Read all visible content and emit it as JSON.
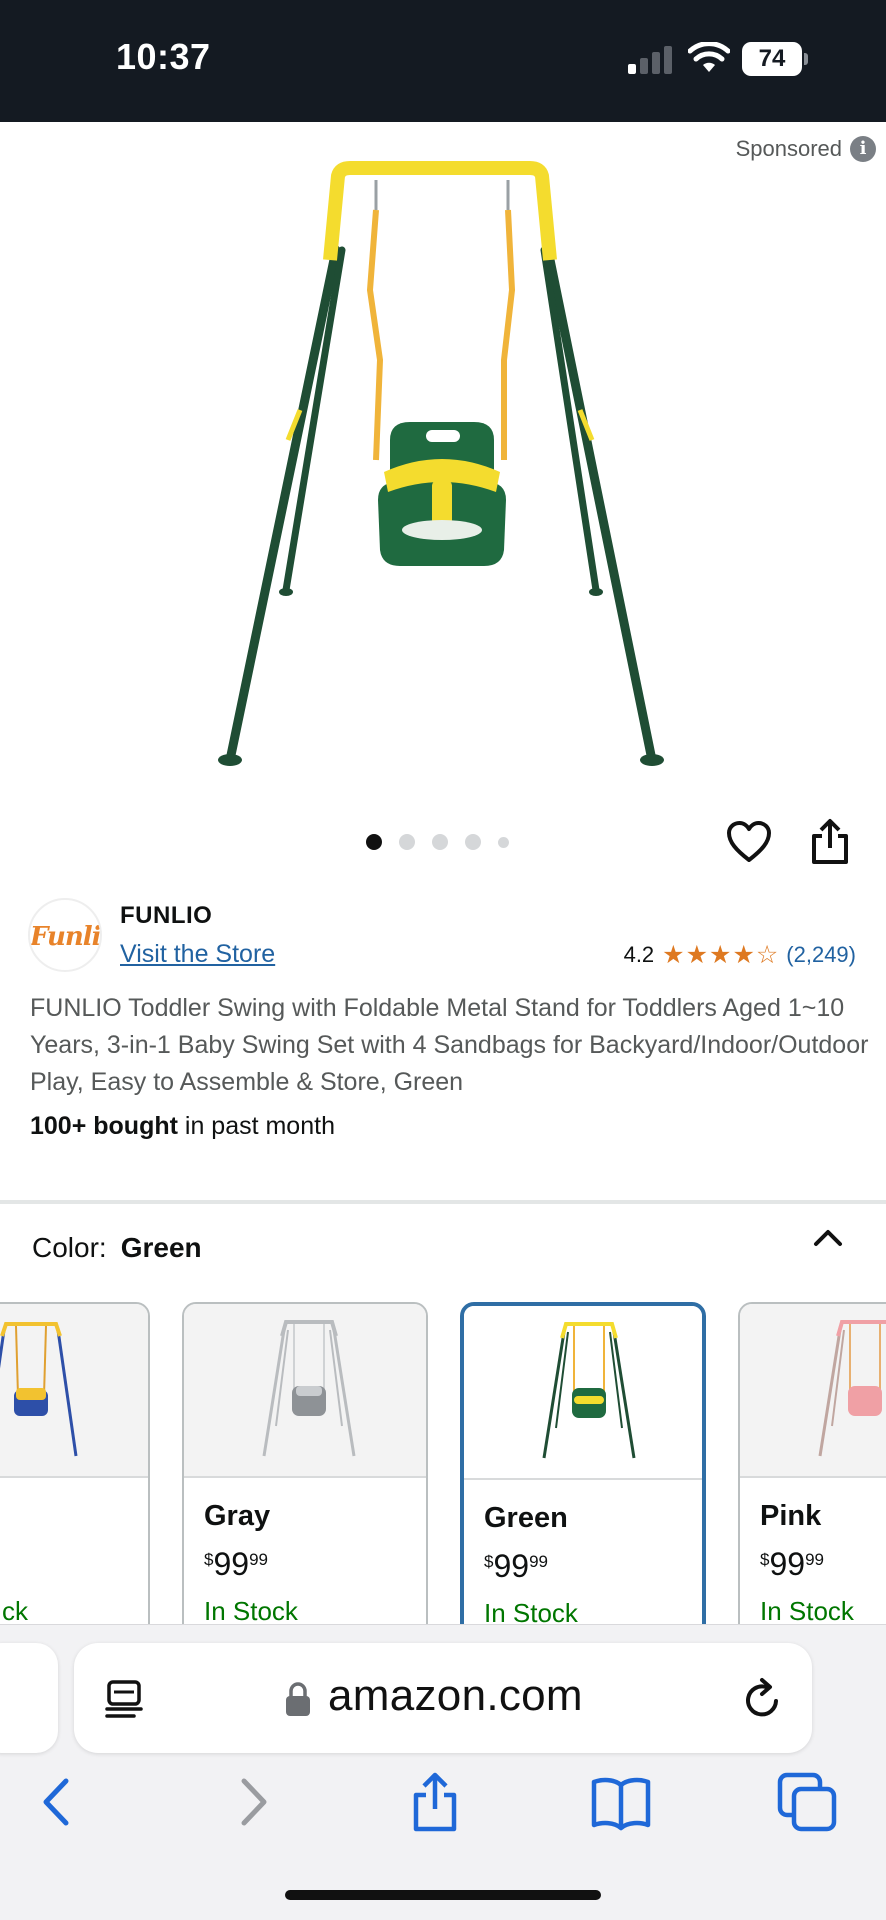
{
  "status_bar": {
    "time": "10:37",
    "battery": "74"
  },
  "sponsored": {
    "label": "Sponsored"
  },
  "carousel": {
    "page_count": 5,
    "active_index": 0
  },
  "brand": {
    "logo_text": "Funlio",
    "name": "FUNLIO",
    "visit_store": "Visit the Store"
  },
  "rating": {
    "value": "4.2",
    "stars": 4.2,
    "count": "(2,249)"
  },
  "product": {
    "title": "FUNLIO Toddler Swing with Foldable Metal Stand for Toddlers Aged 1~10 Years, 3-in-1 Baby Swing Set with 4 Sandbags for Backyard/Indoor/Outdoor Play, Easy to Assemble & Store, Green",
    "bought_bold": "100+ bought",
    "bought_rest": " in past month"
  },
  "color_selector": {
    "label": "Color:",
    "selected": "Green",
    "options": [
      {
        "name": "",
        "price_dollars": "",
        "price_cents": "",
        "stock": "ck",
        "frame": "#2d4fa8",
        "top": "#f2c230",
        "seat": "#f2c230"
      },
      {
        "name": "Gray",
        "price_symbol": "$",
        "price_dollars": "99",
        "price_cents": "99",
        "stock": "In Stock",
        "frame": "#b9bcbf",
        "top": "#b9bcbf",
        "seat": "#8e9296"
      },
      {
        "name": "Green",
        "price_symbol": "$",
        "price_dollars": "99",
        "price_cents": "99",
        "stock": "In Stock",
        "frame": "#1f4d34",
        "top": "#f4dc2e",
        "seat": "#1f6a40"
      },
      {
        "name": "Pink",
        "price_symbol": "$",
        "price_dollars": "99",
        "price_cents": "99",
        "stock": "In Stock",
        "frame": "#c0a6a0",
        "top": "#f0a0a5",
        "seat": "#f0a0a5"
      }
    ]
  },
  "browser": {
    "url": "amazon.com"
  },
  "colors": {
    "link": "#2162a1",
    "star": "#de7921",
    "stock": "#007600",
    "selected_border": "#2f6ea5",
    "safari_blue": "#1f68d8"
  }
}
